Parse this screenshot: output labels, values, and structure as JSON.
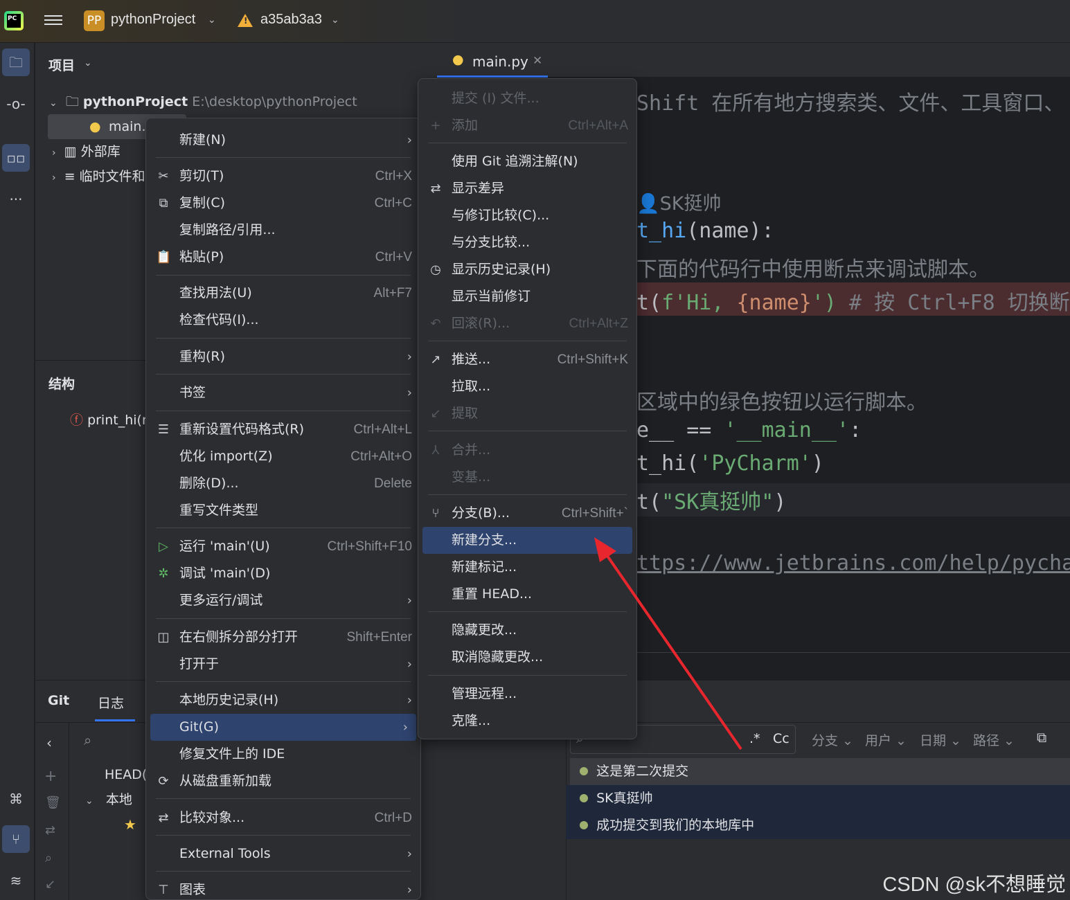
{
  "titlebar": {
    "logo": "PC",
    "project_badge": "PP",
    "project_name": "pythonProject",
    "branch": "a35ab3a3"
  },
  "project_panel": {
    "title": "项目",
    "root_name": "pythonProject",
    "root_path": "E:\\desktop\\pythonProject",
    "file": "main.py",
    "external_libs": "外部库",
    "scratches": "临时文件和控制台",
    "structure_title": "结构",
    "structure_item": "print_hi(name)"
  },
  "editor": {
    "tab": "main.py",
    "lines": [
      {
        "t1": "Shift 在所有地方搜索类、文件、工具窗口、"
      },
      {
        "author": "SK挺帅"
      },
      {
        "t1": "t_hi",
        "t2": "(name):"
      },
      {
        "t1": "下面的代码行中使用断点来调试脚本。"
      },
      {
        "t1": "t(",
        "t2": "f'Hi, ",
        "t3": "{name}",
        "t4": "')",
        "t5": "  # 按 Ctrl+F8 切换断"
      },
      {
        "t1": "区域中的绿色按钮以运行脚本。"
      },
      {
        "t1": "e__ == ",
        "t2": "'__main__'",
        "t3": ":"
      },
      {
        "t1": "t_hi(",
        "t2": "'PyCharm'",
        "t3": ")"
      },
      {
        "t1": "t(",
        "t2": "\"SK真挺帅\"",
        "t3": ")"
      },
      {
        "t1": "ttps://www.jetbrains.com/help/pycha"
      }
    ]
  },
  "git_panel": {
    "tab_git": "Git",
    "tab_log": "日志",
    "head": "HEAD(",
    "local": "本地",
    "filters": {
      "regex": ".*",
      "case": "Cc",
      "branch": "分支",
      "user": "用户",
      "date": "日期",
      "path": "路径"
    },
    "commits": [
      "这是第二次提交",
      "SK真挺帅",
      "成功提交到我们的本地库中"
    ]
  },
  "context_menu": {
    "new": "新建(N)",
    "cut": "剪切(T)",
    "cut_sc": "Ctrl+X",
    "copy": "复制(C)",
    "copy_sc": "Ctrl+C",
    "copy_path": "复制路径/引用...",
    "paste": "粘贴(P)",
    "paste_sc": "Ctrl+V",
    "find_usages": "查找用法(U)",
    "find_usages_sc": "Alt+F7",
    "inspect": "检查代码(I)...",
    "refactor": "重构(R)",
    "bookmarks": "书签",
    "reformat": "重新设置代码格式(R)",
    "reformat_sc": "Ctrl+Alt+L",
    "optimize": "优化 import(Z)",
    "optimize_sc": "Ctrl+Alt+O",
    "delete": "删除(D)...",
    "delete_sc": "Delete",
    "override_type": "重写文件类型",
    "run": "运行 'main'(U)",
    "run_sc": "Ctrl+Shift+F10",
    "debug": "调试 'main'(D)",
    "more_run": "更多运行/调试",
    "split_open": "在右侧拆分部分打开",
    "split_open_sc": "Shift+Enter",
    "open_in": "打开于",
    "local_history": "本地历史记录(H)",
    "git": "Git(G)",
    "fix_ide": "修复文件上的 IDE",
    "reload": "从磁盘重新加载",
    "compare": "比较对象...",
    "compare_sc": "Ctrl+D",
    "external_tools": "External Tools",
    "diagrams": "图表"
  },
  "git_submenu": {
    "commit_file": "提交 (I) 文件...",
    "add": "添加",
    "add_sc": "Ctrl+Alt+A",
    "annotate": "使用 Git 追溯注解(N)",
    "show_diff": "显示差异",
    "compare_revision": "与修订比较(C)...",
    "compare_branch": "与分支比较...",
    "show_history": "显示历史记录(H)",
    "show_current_rev": "显示当前修订",
    "rollback": "回滚(R)...",
    "rollback_sc": "Ctrl+Alt+Z",
    "push": "推送...",
    "push_sc": "Ctrl+Shift+K",
    "pull": "拉取...",
    "fetch": "提取",
    "merge": "合并...",
    "rebase": "变基...",
    "branches": "分支(B)...",
    "branches_sc": "Ctrl+Shift+`",
    "new_branch": "新建分支...",
    "new_tag": "新建标记...",
    "reset_head": "重置 HEAD...",
    "stash": "隐藏更改...",
    "unstash": "取消隐藏更改...",
    "manage_remotes": "管理远程...",
    "clone": "克隆..."
  },
  "watermark": "CSDN @sk不想睡觉",
  "colors": {
    "accent": "#2e436e",
    "arrow": "#e8262d",
    "error_line": "#4b2c2f"
  }
}
